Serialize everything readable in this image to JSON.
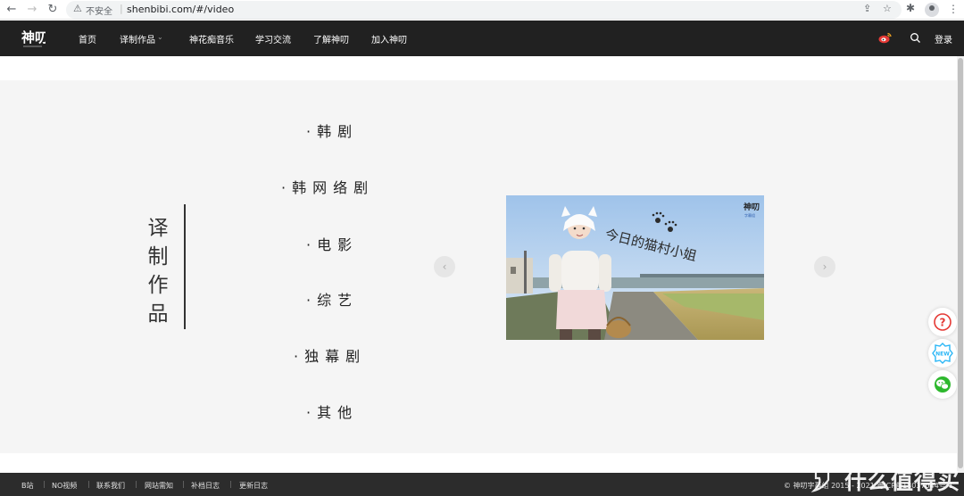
{
  "browser": {
    "security_label": "不安全",
    "url": "shenbibi.com/#/video"
  },
  "header": {
    "logo_text": "神叨",
    "nav": [
      "首页",
      "译制作品",
      "神花痴音乐",
      "学习交流",
      "了解神叨",
      "加入神叨"
    ],
    "login_label": "登录",
    "icons": [
      "weibo-icon",
      "search-icon"
    ]
  },
  "section": {
    "title_chars": [
      "译",
      "制",
      "作",
      "品"
    ],
    "categories": [
      "·韩剧",
      "·韩网络剧",
      "·电影",
      "·综艺",
      "·独幕剧",
      "·其他"
    ]
  },
  "slide": {
    "caption": "今日的猫村小姐",
    "badge": "神叨",
    "badge_sub": "字幕组"
  },
  "float_buttons": [
    "help-icon",
    "new-badge-icon",
    "wechat-icon"
  ],
  "footer": {
    "links": [
      "B站",
      "NO视频",
      "联系我们",
      "网站需知",
      "补档日志",
      "更新日志"
    ],
    "copyright": "© 神叨字幕组 2015 - 2021  粤ICP备18037044号-1"
  },
  "watermark": "什么值得买",
  "colors": {
    "header_bg": "#212121",
    "panel_bg": "#f5f5f5",
    "footer_bg": "#2c2c2c",
    "help_red": "#e53935",
    "new_blue": "#29b6f6",
    "wechat_green": "#2eb82e"
  }
}
